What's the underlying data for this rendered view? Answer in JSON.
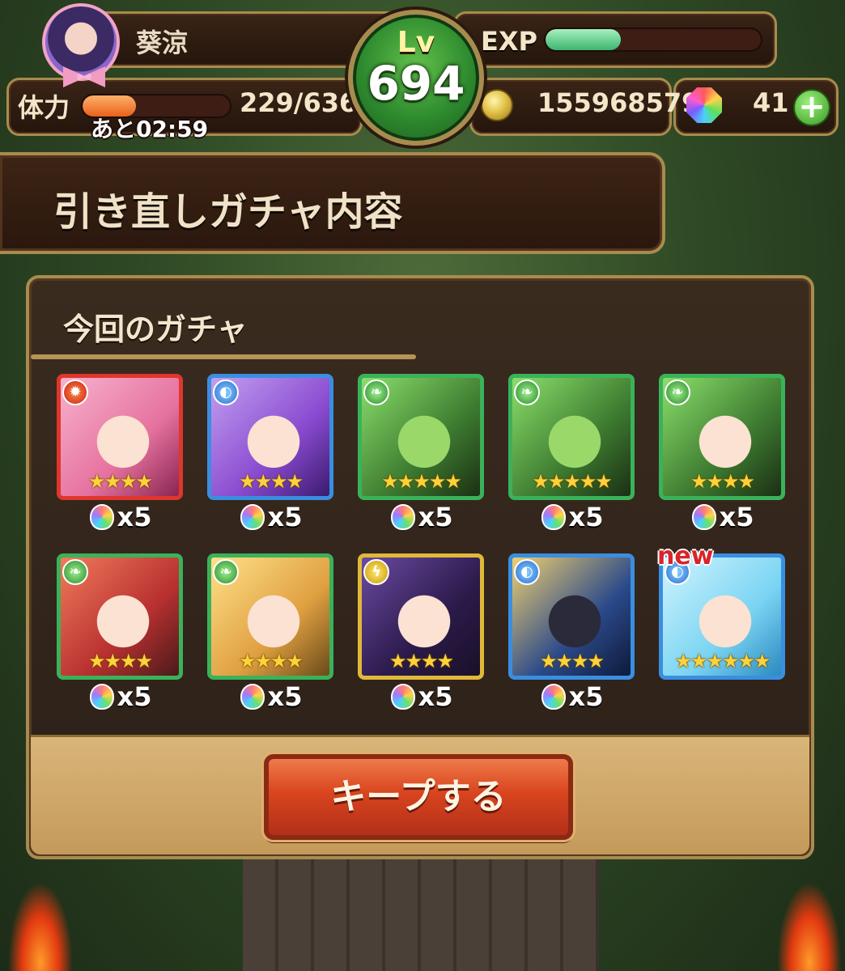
{
  "player": {
    "name": "葵涼",
    "level_label": "Lv",
    "level": "694",
    "exp_label": "EXP",
    "exp_progress": 0.35
  },
  "stats": {
    "stamina_label": "体力",
    "stamina_value": "229/636",
    "stamina_progress": 0.36,
    "stamina_timer": "あと02:59",
    "coins": "155968579",
    "gems": "41",
    "add_gems_label": "+"
  },
  "title": "引き直しガチャ内容",
  "panel": {
    "subtitle": "今回のガチャ"
  },
  "results": [
    {
      "element": "fire",
      "stars": "★★★★",
      "count": "x5",
      "new": false
    },
    {
      "element": "water",
      "stars": "★★★★",
      "count": "x5",
      "new": false
    },
    {
      "element": "wood",
      "stars": "★★★★★",
      "count": "x5",
      "new": false
    },
    {
      "element": "wood",
      "stars": "★★★★★",
      "count": "x5",
      "new": false
    },
    {
      "element": "wood",
      "stars": "★★★★",
      "count": "x5",
      "new": false
    },
    {
      "element": "wood",
      "stars": "★★★★",
      "count": "x5",
      "new": false
    },
    {
      "element": "wood",
      "stars": "★★★★",
      "count": "x5",
      "new": false
    },
    {
      "element": "light",
      "stars": "★★★★",
      "count": "x5",
      "new": false
    },
    {
      "element": "water",
      "stars": "★★★★",
      "count": "x5",
      "new": false
    },
    {
      "element": "water",
      "stars": "★★★★★★",
      "count": "",
      "new": true
    }
  ],
  "new_badge": "new",
  "keep_button": "キープする",
  "colors": {
    "frame_gold": "#a88b4e",
    "button_red": "#d8441e",
    "fire": "#e0362d",
    "water": "#3a8ee0",
    "wood": "#3ab25a",
    "light": "#e0b83a"
  }
}
